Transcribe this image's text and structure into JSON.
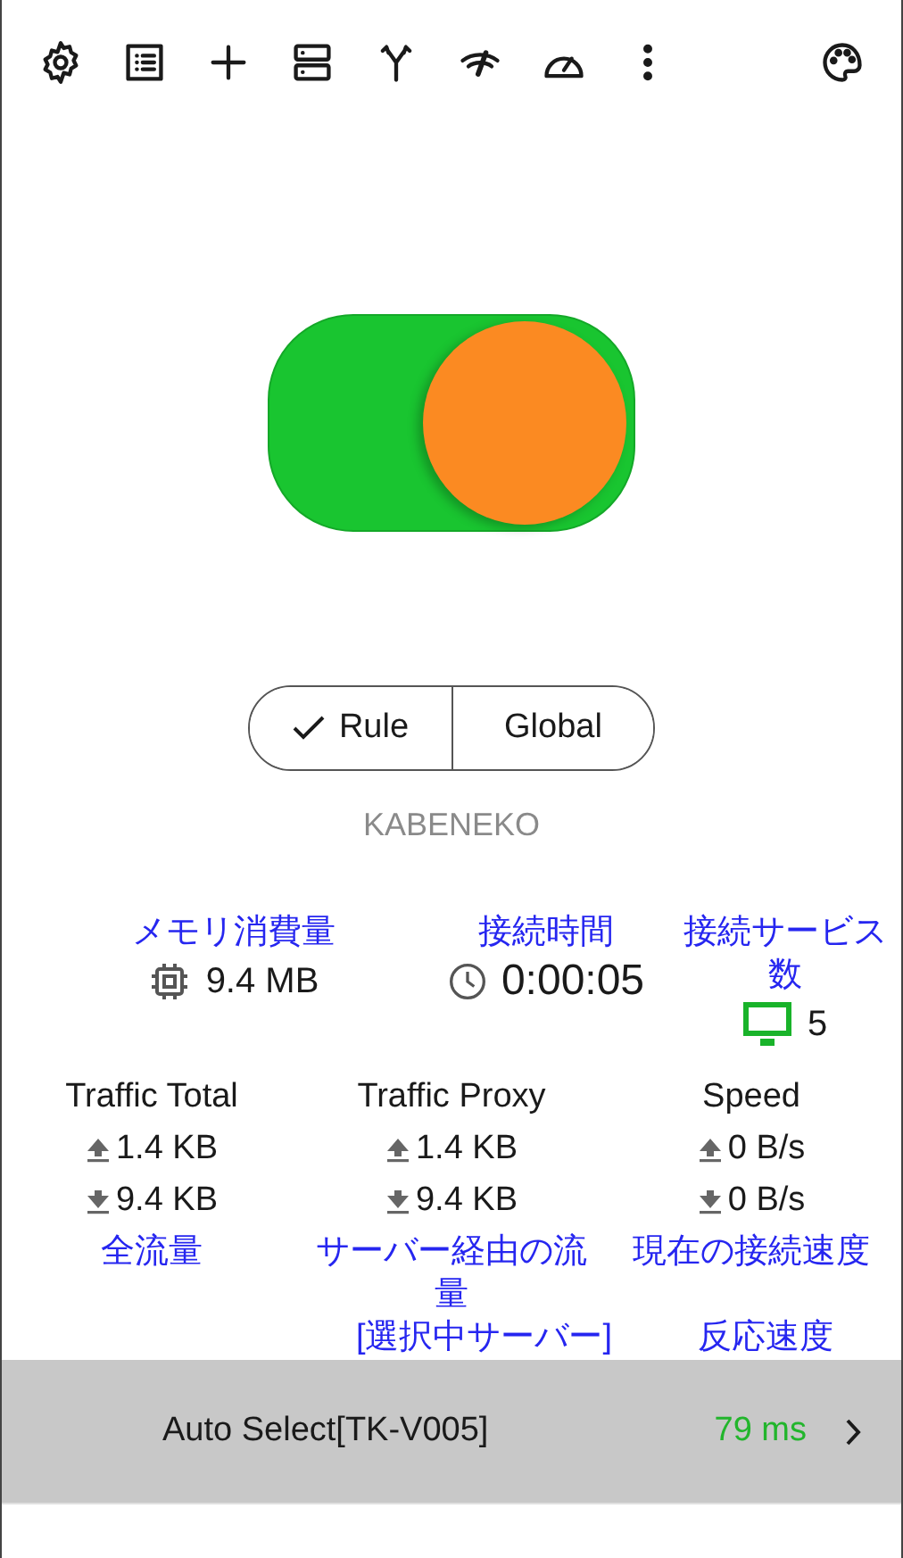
{
  "switch": {
    "on": true
  },
  "modes": [
    {
      "label": "Rule",
      "selected": true
    },
    {
      "label": "Global",
      "selected": false
    }
  ],
  "profile": "KABENEKO",
  "stats": [
    {
      "kind": "memory",
      "label": "メモリ消費量",
      "value": "9.4 MB"
    },
    {
      "kind": "time",
      "label": "接続時間",
      "value": "0:00:05"
    },
    {
      "kind": "connections",
      "label": "接続サービス数",
      "value": "5"
    }
  ],
  "traffic": [
    {
      "title": "Traffic Total",
      "up": "1.4 KB",
      "down": "9.4 KB",
      "note": "全流量"
    },
    {
      "title": "Traffic Proxy",
      "up": "1.4 KB",
      "down": "9.4 KB",
      "note": "サーバー経由の流量"
    },
    {
      "title": "Speed",
      "up": "0 B/s",
      "down": "0 B/s",
      "note": "現在の接続速度"
    }
  ],
  "server": {
    "caption": "[選択中サーバー]",
    "latency_caption": "反応速度",
    "name": "Auto Select[TK-V005]",
    "latency": "79 ms"
  }
}
